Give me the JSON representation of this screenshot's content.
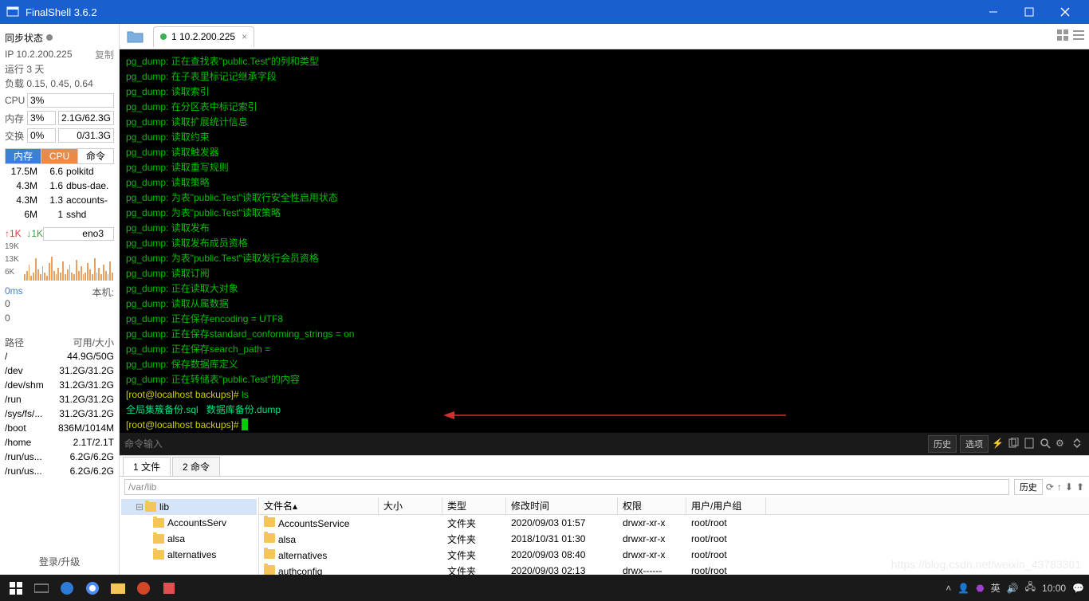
{
  "window": {
    "title": "FinalShell 3.6.2"
  },
  "sidebar": {
    "sync_label": "同步状态",
    "ip_label": "IP 10.2.200.225",
    "copy_label": "复制",
    "uptime": "运行 3 天",
    "load": "负载 0.15, 0.45, 0.64",
    "cpu_label": "CPU",
    "cpu_pct": "3%",
    "mem_label": "内存",
    "mem_pct": "3%",
    "mem_val": "2.1G/62.3G",
    "swap_label": "交换",
    "swap_pct": "0%",
    "swap_val": "0/31.3G",
    "proc_tabs": {
      "mem": "内存",
      "cpu": "CPU",
      "cmd": "命令"
    },
    "procs": [
      {
        "m": "17.5M",
        "c": "6.6",
        "n": "polkitd"
      },
      {
        "m": "4.3M",
        "c": "1.6",
        "n": "dbus-dae."
      },
      {
        "m": "4.3M",
        "c": "1.3",
        "n": "accounts-"
      },
      {
        "m": "6M",
        "c": "1",
        "n": "sshd"
      }
    ],
    "net_up": "1K",
    "net_dn": "1K",
    "net_if": "eno3",
    "y1": "19K",
    "y2": "13K",
    "y3": "6K",
    "ping": "0ms",
    "benji": "本机:",
    "z1": "0",
    "z2": "0",
    "disk_h1": "路径",
    "disk_h2": "可用/大小",
    "disks": [
      {
        "p": "/",
        "v": "44.9G/50G"
      },
      {
        "p": "/dev",
        "v": "31.2G/31.2G"
      },
      {
        "p": "/dev/shm",
        "v": "31.2G/31.2G"
      },
      {
        "p": "/run",
        "v": "31.2G/31.2G"
      },
      {
        "p": "/sys/fs/...",
        "v": "31.2G/31.2G"
      },
      {
        "p": "/boot",
        "v": "836M/1014M"
      },
      {
        "p": "/home",
        "v": "2.1T/2.1T"
      },
      {
        "p": "/run/us...",
        "v": "6.2G/6.2G"
      },
      {
        "p": "/run/us...",
        "v": "6.2G/6.2G"
      }
    ],
    "login": "登录/升级"
  },
  "tab": {
    "label": "1 10.2.200.225",
    "close": "×"
  },
  "term_lines": [
    "pg_dump: 正在查找表\"public.Test\"的列和类型",
    "pg_dump: 在子表里标记记继承字段",
    "pg_dump: 读取索引",
    "pg_dump: 在分区表中标记索引",
    "pg_dump: 读取扩展统计信息",
    "pg_dump: 读取约束",
    "pg_dump: 读取触发器",
    "pg_dump: 读取重写规则",
    "pg_dump: 读取策略",
    "pg_dump: 为表\"public.Test\"读取行安全性启用状态",
    "pg_dump: 为表\"public.Test\"读取策略",
    "pg_dump: 读取发布",
    "pg_dump: 读取发布成员资格",
    "pg_dump: 为表\"public.Test\"读取发行会员资格",
    "pg_dump: 读取订阅",
    "pg_dump: 正在读取大对象",
    "pg_dump: 读取从属数据",
    "pg_dump: 正在保存encoding = UTF8",
    "pg_dump: 正在保存standard_conforming_strings = on",
    "pg_dump: 正在保存search_path = ",
    "pg_dump: 保存数据库定义",
    "pg_dump: 正在转储表\"public.Test\"的内容"
  ],
  "prompt1": "[root@localhost backups]# ",
  "ls_cmd": "ls",
  "ls_out": {
    "f1": "全局集簇备份.sql",
    "sp": "   ",
    "f2": "数据库备份.dump"
  },
  "prompt2": "[root@localhost backups]# ",
  "cmd_placeholder": "命令输入",
  "cmd_btns": {
    "history": "历史",
    "options": "选项"
  },
  "bp": {
    "tab1": "1 文件",
    "tab2": "2 命令",
    "path": "/var/lib",
    "history": "历史"
  },
  "tree": [
    {
      "indent": 18,
      "exp": "⊟",
      "label": "lib",
      "sel": true
    },
    {
      "indent": 40,
      "exp": "",
      "label": "AccountsServ"
    },
    {
      "indent": 40,
      "exp": "",
      "label": "alsa"
    },
    {
      "indent": 40,
      "exp": "",
      "label": "alternatives"
    }
  ],
  "ft_hdr": {
    "name": "文件名",
    "size": "大小",
    "type": "类型",
    "mtime": "修改时间",
    "perm": "权限",
    "user": "用户/用户组"
  },
  "ft_rows": [
    {
      "name": "AccountsService",
      "type": "文件夹",
      "mtime": "2020/09/03 01:57",
      "perm": "drwxr-xr-x",
      "user": "root/root"
    },
    {
      "name": "alsa",
      "type": "文件夹",
      "mtime": "2018/10/31 01:30",
      "perm": "drwxr-xr-x",
      "user": "root/root"
    },
    {
      "name": "alternatives",
      "type": "文件夹",
      "mtime": "2020/09/03 08:40",
      "perm": "drwxr-xr-x",
      "user": "root/root"
    },
    {
      "name": "authconfig",
      "type": "文件夹",
      "mtime": "2020/09/03 02:13",
      "perm": "drwx------",
      "user": "root/root"
    }
  ],
  "tray": {
    "ime": "英",
    "time": "10:00"
  },
  "watermark": "https://blog.csdn.net/weixin_43783301"
}
